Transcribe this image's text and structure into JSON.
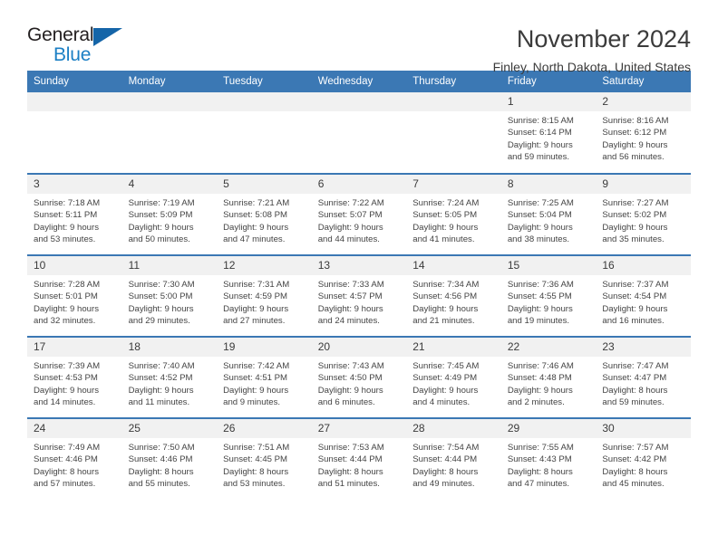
{
  "brand": {
    "name_part1": "General",
    "name_part2": "Blue",
    "accent_color": "#1b7fc4",
    "triangle_color": "#1565a8"
  },
  "header": {
    "month_title": "November 2024",
    "location": "Finley, North Dakota, United States",
    "header_bg_color": "#3b78b4",
    "row_separator_color": "#3b78b4",
    "daynum_bg_color": "#f1f1f1"
  },
  "weekdays": [
    "Sunday",
    "Monday",
    "Tuesday",
    "Wednesday",
    "Thursday",
    "Friday",
    "Saturday"
  ],
  "weeks": [
    [
      {
        "blank": true,
        "day": "",
        "sunrise": "",
        "sunset": "",
        "daylight_line1": "",
        "daylight_line2": ""
      },
      {
        "blank": true,
        "day": "",
        "sunrise": "",
        "sunset": "",
        "daylight_line1": "",
        "daylight_line2": ""
      },
      {
        "blank": true,
        "day": "",
        "sunrise": "",
        "sunset": "",
        "daylight_line1": "",
        "daylight_line2": ""
      },
      {
        "blank": true,
        "day": "",
        "sunrise": "",
        "sunset": "",
        "daylight_line1": "",
        "daylight_line2": ""
      },
      {
        "blank": true,
        "day": "",
        "sunrise": "",
        "sunset": "",
        "daylight_line1": "",
        "daylight_line2": ""
      },
      {
        "blank": false,
        "day": "1",
        "sunrise": "Sunrise: 8:15 AM",
        "sunset": "Sunset: 6:14 PM",
        "daylight_line1": "Daylight: 9 hours",
        "daylight_line2": "and 59 minutes."
      },
      {
        "blank": false,
        "day": "2",
        "sunrise": "Sunrise: 8:16 AM",
        "sunset": "Sunset: 6:12 PM",
        "daylight_line1": "Daylight: 9 hours",
        "daylight_line2": "and 56 minutes."
      }
    ],
    [
      {
        "blank": false,
        "day": "3",
        "sunrise": "Sunrise: 7:18 AM",
        "sunset": "Sunset: 5:11 PM",
        "daylight_line1": "Daylight: 9 hours",
        "daylight_line2": "and 53 minutes."
      },
      {
        "blank": false,
        "day": "4",
        "sunrise": "Sunrise: 7:19 AM",
        "sunset": "Sunset: 5:09 PM",
        "daylight_line1": "Daylight: 9 hours",
        "daylight_line2": "and 50 minutes."
      },
      {
        "blank": false,
        "day": "5",
        "sunrise": "Sunrise: 7:21 AM",
        "sunset": "Sunset: 5:08 PM",
        "daylight_line1": "Daylight: 9 hours",
        "daylight_line2": "and 47 minutes."
      },
      {
        "blank": false,
        "day": "6",
        "sunrise": "Sunrise: 7:22 AM",
        "sunset": "Sunset: 5:07 PM",
        "daylight_line1": "Daylight: 9 hours",
        "daylight_line2": "and 44 minutes."
      },
      {
        "blank": false,
        "day": "7",
        "sunrise": "Sunrise: 7:24 AM",
        "sunset": "Sunset: 5:05 PM",
        "daylight_line1": "Daylight: 9 hours",
        "daylight_line2": "and 41 minutes."
      },
      {
        "blank": false,
        "day": "8",
        "sunrise": "Sunrise: 7:25 AM",
        "sunset": "Sunset: 5:04 PM",
        "daylight_line1": "Daylight: 9 hours",
        "daylight_line2": "and 38 minutes."
      },
      {
        "blank": false,
        "day": "9",
        "sunrise": "Sunrise: 7:27 AM",
        "sunset": "Sunset: 5:02 PM",
        "daylight_line1": "Daylight: 9 hours",
        "daylight_line2": "and 35 minutes."
      }
    ],
    [
      {
        "blank": false,
        "day": "10",
        "sunrise": "Sunrise: 7:28 AM",
        "sunset": "Sunset: 5:01 PM",
        "daylight_line1": "Daylight: 9 hours",
        "daylight_line2": "and 32 minutes."
      },
      {
        "blank": false,
        "day": "11",
        "sunrise": "Sunrise: 7:30 AM",
        "sunset": "Sunset: 5:00 PM",
        "daylight_line1": "Daylight: 9 hours",
        "daylight_line2": "and 29 minutes."
      },
      {
        "blank": false,
        "day": "12",
        "sunrise": "Sunrise: 7:31 AM",
        "sunset": "Sunset: 4:59 PM",
        "daylight_line1": "Daylight: 9 hours",
        "daylight_line2": "and 27 minutes."
      },
      {
        "blank": false,
        "day": "13",
        "sunrise": "Sunrise: 7:33 AM",
        "sunset": "Sunset: 4:57 PM",
        "daylight_line1": "Daylight: 9 hours",
        "daylight_line2": "and 24 minutes."
      },
      {
        "blank": false,
        "day": "14",
        "sunrise": "Sunrise: 7:34 AM",
        "sunset": "Sunset: 4:56 PM",
        "daylight_line1": "Daylight: 9 hours",
        "daylight_line2": "and 21 minutes."
      },
      {
        "blank": false,
        "day": "15",
        "sunrise": "Sunrise: 7:36 AM",
        "sunset": "Sunset: 4:55 PM",
        "daylight_line1": "Daylight: 9 hours",
        "daylight_line2": "and 19 minutes."
      },
      {
        "blank": false,
        "day": "16",
        "sunrise": "Sunrise: 7:37 AM",
        "sunset": "Sunset: 4:54 PM",
        "daylight_line1": "Daylight: 9 hours",
        "daylight_line2": "and 16 minutes."
      }
    ],
    [
      {
        "blank": false,
        "day": "17",
        "sunrise": "Sunrise: 7:39 AM",
        "sunset": "Sunset: 4:53 PM",
        "daylight_line1": "Daylight: 9 hours",
        "daylight_line2": "and 14 minutes."
      },
      {
        "blank": false,
        "day": "18",
        "sunrise": "Sunrise: 7:40 AM",
        "sunset": "Sunset: 4:52 PM",
        "daylight_line1": "Daylight: 9 hours",
        "daylight_line2": "and 11 minutes."
      },
      {
        "blank": false,
        "day": "19",
        "sunrise": "Sunrise: 7:42 AM",
        "sunset": "Sunset: 4:51 PM",
        "daylight_line1": "Daylight: 9 hours",
        "daylight_line2": "and 9 minutes."
      },
      {
        "blank": false,
        "day": "20",
        "sunrise": "Sunrise: 7:43 AM",
        "sunset": "Sunset: 4:50 PM",
        "daylight_line1": "Daylight: 9 hours",
        "daylight_line2": "and 6 minutes."
      },
      {
        "blank": false,
        "day": "21",
        "sunrise": "Sunrise: 7:45 AM",
        "sunset": "Sunset: 4:49 PM",
        "daylight_line1": "Daylight: 9 hours",
        "daylight_line2": "and 4 minutes."
      },
      {
        "blank": false,
        "day": "22",
        "sunrise": "Sunrise: 7:46 AM",
        "sunset": "Sunset: 4:48 PM",
        "daylight_line1": "Daylight: 9 hours",
        "daylight_line2": "and 2 minutes."
      },
      {
        "blank": false,
        "day": "23",
        "sunrise": "Sunrise: 7:47 AM",
        "sunset": "Sunset: 4:47 PM",
        "daylight_line1": "Daylight: 8 hours",
        "daylight_line2": "and 59 minutes."
      }
    ],
    [
      {
        "blank": false,
        "day": "24",
        "sunrise": "Sunrise: 7:49 AM",
        "sunset": "Sunset: 4:46 PM",
        "daylight_line1": "Daylight: 8 hours",
        "daylight_line2": "and 57 minutes."
      },
      {
        "blank": false,
        "day": "25",
        "sunrise": "Sunrise: 7:50 AM",
        "sunset": "Sunset: 4:46 PM",
        "daylight_line1": "Daylight: 8 hours",
        "daylight_line2": "and 55 minutes."
      },
      {
        "blank": false,
        "day": "26",
        "sunrise": "Sunrise: 7:51 AM",
        "sunset": "Sunset: 4:45 PM",
        "daylight_line1": "Daylight: 8 hours",
        "daylight_line2": "and 53 minutes."
      },
      {
        "blank": false,
        "day": "27",
        "sunrise": "Sunrise: 7:53 AM",
        "sunset": "Sunset: 4:44 PM",
        "daylight_line1": "Daylight: 8 hours",
        "daylight_line2": "and 51 minutes."
      },
      {
        "blank": false,
        "day": "28",
        "sunrise": "Sunrise: 7:54 AM",
        "sunset": "Sunset: 4:44 PM",
        "daylight_line1": "Daylight: 8 hours",
        "daylight_line2": "and 49 minutes."
      },
      {
        "blank": false,
        "day": "29",
        "sunrise": "Sunrise: 7:55 AM",
        "sunset": "Sunset: 4:43 PM",
        "daylight_line1": "Daylight: 8 hours",
        "daylight_line2": "and 47 minutes."
      },
      {
        "blank": false,
        "day": "30",
        "sunrise": "Sunrise: 7:57 AM",
        "sunset": "Sunset: 4:42 PM",
        "daylight_line1": "Daylight: 8 hours",
        "daylight_line2": "and 45 minutes."
      }
    ]
  ]
}
